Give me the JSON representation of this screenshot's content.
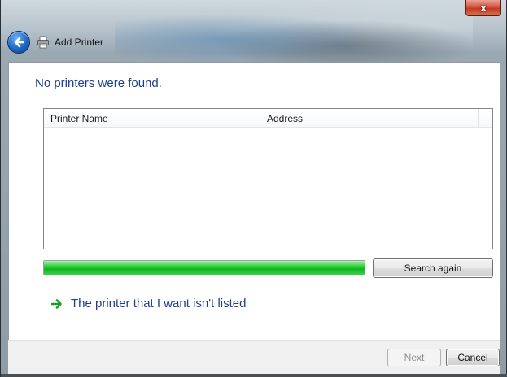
{
  "window": {
    "title": "Add Printer",
    "close_label": "x"
  },
  "icons": {
    "back": "back-arrow-icon",
    "printer": "printer-icon",
    "link_arrow": "green-arrow-icon"
  },
  "main": {
    "heading": "No printers were found.",
    "list": {
      "columns": [
        "Printer Name",
        "Address"
      ],
      "rows": []
    },
    "progress": {
      "fraction": 1.0,
      "color": "#22c42c"
    },
    "search_again_label": "Search again",
    "not_listed_link": "The printer that I want isn't listed"
  },
  "footer": {
    "next_label": "Next",
    "next_enabled": false,
    "cancel_label": "Cancel"
  },
  "colors": {
    "heading": "#1e3f8f",
    "link": "#1e3f8f",
    "close_button": "#c7432b"
  }
}
